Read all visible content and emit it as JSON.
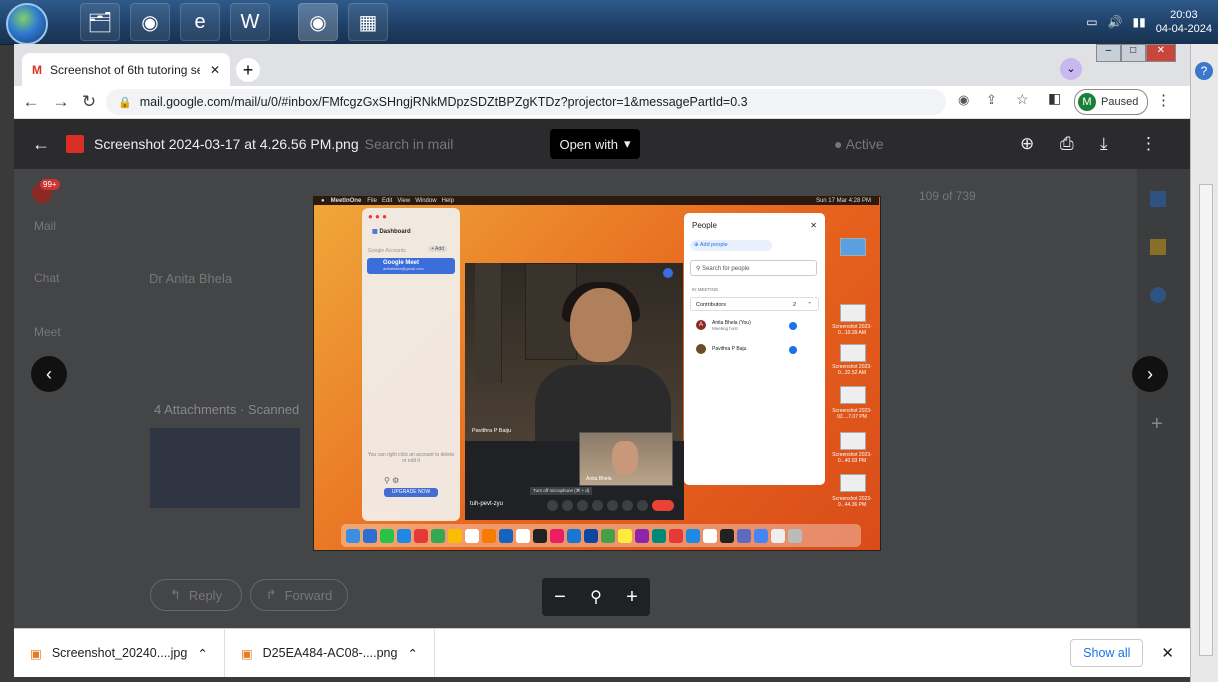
{
  "taskbar": {
    "clock_time": "20:03",
    "clock_date": "04-04-2024",
    "apps": [
      "folder-icon",
      "chrome-icon",
      "internet-explorer-icon",
      "word-icon",
      "chrome-profile-icon",
      "paint-icon"
    ]
  },
  "browser": {
    "tab_title": "Screenshot of 6th tutoring sessio",
    "url": "mail.google.com/mail/u/0/#inbox/FMfcgzGxSHngjRNkMDpzSDZtBPZgKTDz?projector=1&messagePartId=0.3",
    "profile_initial": "M",
    "profile_status": "Paused"
  },
  "viewer": {
    "file_name": "Screenshot 2024-03-17 at 4.26.56 PM.png",
    "open_with": "Open with"
  },
  "gmail_bg": {
    "search_placeholder": "Search in mail",
    "status": "Active",
    "counter": "109 of 739",
    "sender": "Dr Anita Bhela",
    "attachments": "4 Attachments · Scanned",
    "reply": "Reply",
    "forward": "Forward",
    "nav_mail": "Mail",
    "nav_chat": "Chat",
    "nav_meet": "Meet",
    "badge": "99+"
  },
  "screenshot": {
    "mac_app": "MeetInOne",
    "mac_menu": [
      "File",
      "Edit",
      "View",
      "Window",
      "Help"
    ],
    "mac_clock": "Sun 17 Mar 4:28 PM",
    "dashboard": "Dashboard",
    "accounts_label": "Google Accounts",
    "add_label": "+ Add",
    "meet_item": "Google Meet",
    "meet_email": "anitabhela@gmail.com",
    "help_text": "You can right click an account to delete or edit it",
    "upgrade": "UPGRADE NOW",
    "participant_name": "Pavithra P Baiju",
    "pip_name": "Anita Bhela",
    "meeting_code": "tuh-pevt-zyu",
    "mic_tooltip": "Turn off microphone (⌘ + d)",
    "people_title": "People",
    "add_people": "Add people",
    "search_people": "Search for people",
    "in_meeting": "IN MEETING",
    "contributors": "Contributors",
    "contributors_count": "2",
    "person1_name": "Anita Bhela (You)",
    "person1_role": "Meeting host",
    "person2_name": "Pavithra P Baju",
    "desktop_files": [
      "Screenshot 2023-0...10.39 AM",
      "Screenshot 2023-0...32.52 AM",
      "Screenshot 2023-02....7.07 PM",
      "Screenshot 2023-0...40.03 PM",
      "Screenshot 2023-0...44.36 PM"
    ]
  },
  "downloads": {
    "item1": "Screenshot_20240....jpg",
    "item2": "D25EA484-AC08-....png",
    "show_all": "Show all"
  }
}
